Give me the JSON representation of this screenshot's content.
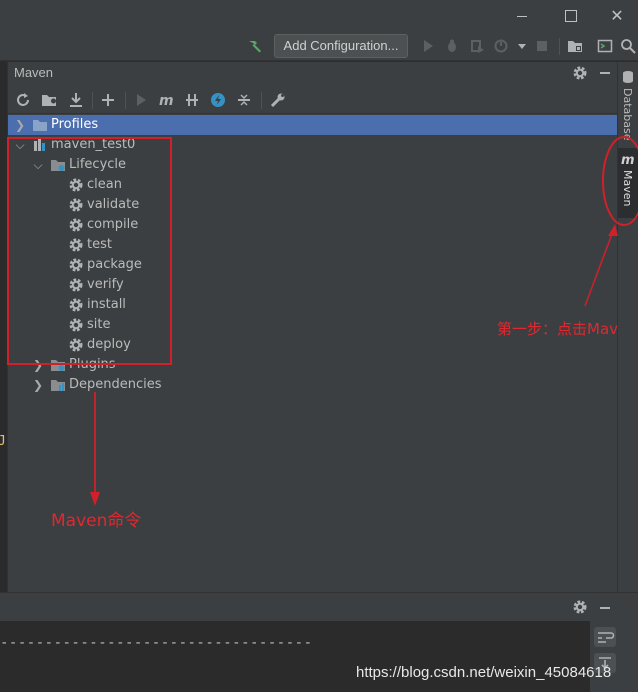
{
  "toolbar": {
    "add_configuration_label": "Add Configuration..."
  },
  "panel": {
    "title": "Maven"
  },
  "tree": {
    "profiles": "Profiles",
    "project": "maven_test0",
    "lifecycle": "Lifecycle",
    "goals": [
      "clean",
      "validate",
      "compile",
      "test",
      "package",
      "verify",
      "install",
      "site",
      "deploy"
    ],
    "plugins": "Plugins",
    "dependencies": "Dependencies"
  },
  "right_stripe": {
    "database_label": "Database",
    "maven_label": "Maven"
  },
  "console": {
    "dashes": "-----------------------------------"
  },
  "annotations": {
    "step1": "第一步：点击Mav",
    "maven_commands": "Maven命令"
  },
  "watermark": "https://blog.csdn.net/weixin_45084618",
  "colors": {
    "selection": "#4b6eaf",
    "annotation": "#d0202a",
    "panel_bg": "#3c3f41"
  }
}
